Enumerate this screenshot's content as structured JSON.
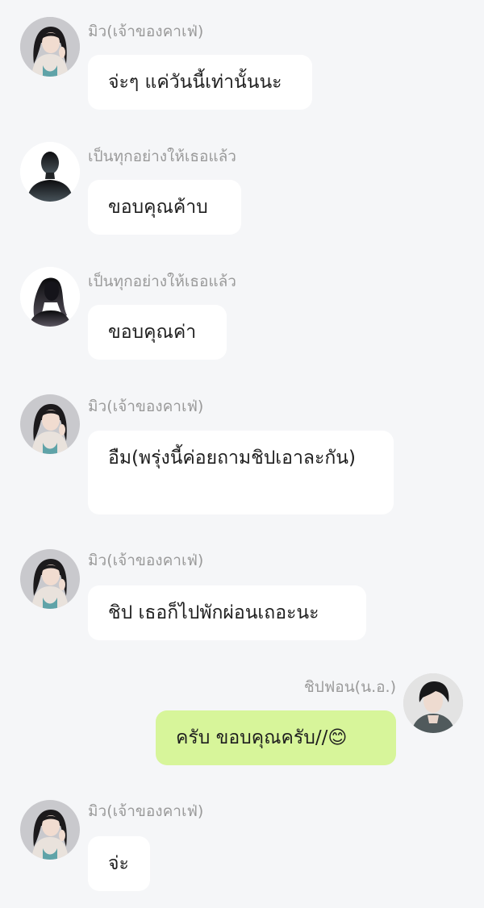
{
  "colors": {
    "background": "#f5f6f8",
    "incoming_bubble": "#ffffff",
    "outgoing_bubble": "#d7f59a",
    "sender_name": "#9a9a9a",
    "message_text": "#1e1e1e"
  },
  "messages": [
    {
      "sender": "มิว(เจ้าของคาเฟ่)",
      "avatar": "girl-photo-avatar",
      "text": "จ่ะๆ แค่วันนี้เท่านั้นนะ",
      "side": "left"
    },
    {
      "sender": "เป็นทุกอย่างให้เธอแล้ว",
      "avatar": "male-silhouette-avatar",
      "text": "ขอบคุณค้าบ",
      "side": "left"
    },
    {
      "sender": "เป็นทุกอย่างให้เธอแล้ว",
      "avatar": "female-silhouette-avatar",
      "text": "ขอบคุณค่า",
      "side": "left"
    },
    {
      "sender": "มิว(เจ้าของคาเฟ่)",
      "avatar": "girl-photo-avatar",
      "text": "อืม(พรุ่งนี้ค่อยถามชิปเอาละกัน)",
      "side": "left"
    },
    {
      "sender": "มิว(เจ้าของคาเฟ่)",
      "avatar": "girl-photo-avatar",
      "text": "ชิป เธอก็ไปพักผ่อนเถอะนะ",
      "side": "left"
    },
    {
      "sender": "ชิปฟอน(น.อ.)",
      "avatar": "boy-photo-avatar",
      "text": "ครับ ขอบคุณครับ//😊",
      "side": "right"
    },
    {
      "sender": "มิว(เจ้าของคาเฟ่)",
      "avatar": "girl-photo-avatar",
      "text": "จ่ะ",
      "side": "left"
    }
  ]
}
